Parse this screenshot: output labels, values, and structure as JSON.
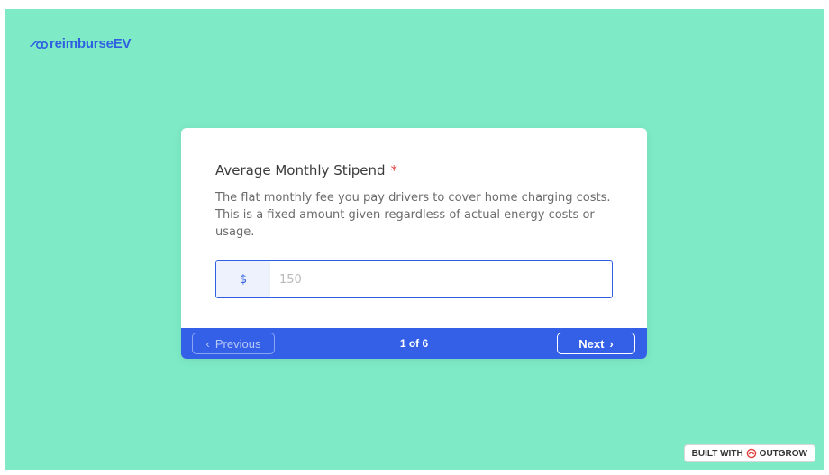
{
  "app": {
    "logo_text": "reimburseEV",
    "logo_icon": "ev-plug-icon"
  },
  "question": {
    "title": "Average Monthly Stipend",
    "required_mark": "*",
    "description": "The flat monthly fee you pay drivers to cover home charging costs. This is a fixed amount given regardless of actual energy costs or usage."
  },
  "input": {
    "prefix": "$",
    "placeholder": "150",
    "value": ""
  },
  "footer": {
    "previous_label": "Previous",
    "next_label": "Next",
    "pager_text": "1 of 6"
  },
  "badge": {
    "built_with": "BUILT WITH",
    "brand": "OUTGROW",
    "icon": "outgrow-logo-icon"
  },
  "colors": {
    "background": "#7eebc6",
    "accent": "#3460e8",
    "required": "#e0413e"
  }
}
